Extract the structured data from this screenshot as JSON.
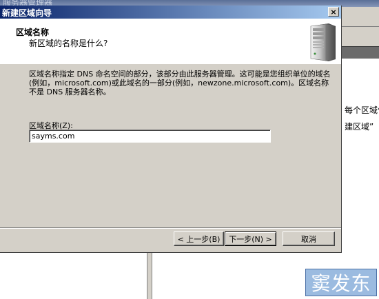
{
  "background_window": {
    "title": "服务器管理器",
    "snippet_1": "每个区域使",
    "snippet_2": "建区域”"
  },
  "dialog": {
    "title": "新建区域向导",
    "close_glyph": "×",
    "header": {
      "title": "区域名称",
      "subtitle": "新区域的名称是什么?"
    },
    "description": "区域名称指定 DNS 命名空间的部分，该部分由此服务器管理。这可能是您组织单位的域名(例如，microsoft.com)或此域名的一部分(例如，newzone.microsoft.com)。区域名称不是 DNS 服务器名称。",
    "zone_name_label": "区域名称(Z):",
    "zone_name_value": "sayms.com",
    "buttons": {
      "back": "< 上一步(B)",
      "next": "下一步(N) >",
      "cancel": "取消"
    }
  },
  "watermark": "窦发东",
  "icons": {
    "header_icon": "server-tower-icon"
  }
}
